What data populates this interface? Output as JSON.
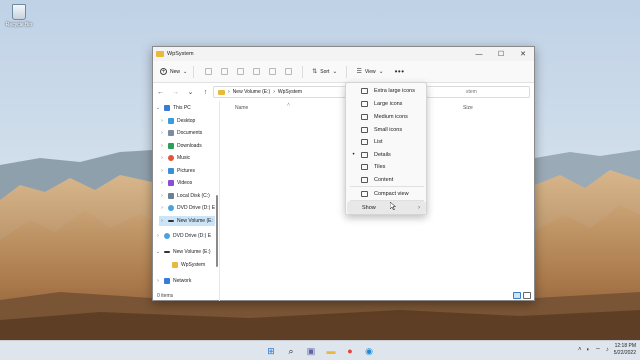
{
  "desktop": {
    "recycle_bin_label": "Recycle Bin"
  },
  "window": {
    "title": "WpSystem",
    "controls": {
      "minimize": "—",
      "maximize": "☐",
      "close": "✕"
    }
  },
  "toolbar": {
    "new_label": "New",
    "sort_label": "Sort",
    "view_label": "View",
    "more_label": "•••"
  },
  "address": {
    "back": "←",
    "forward": "→",
    "recent": "⌄",
    "up": "↑",
    "path": [
      "New Volume (E:)",
      "WpSystem"
    ],
    "separator": "›",
    "search_placeholder": "stem"
  },
  "sidebar": {
    "items": [
      {
        "label": "This PC",
        "chevron": "⌄",
        "icon_color": "#3a7bd5"
      },
      {
        "label": "Desktop",
        "chevron": "›",
        "icon_color": "#3a9be0"
      },
      {
        "label": "Documents",
        "chevron": "›",
        "icon_color": "#7a8c9e"
      },
      {
        "label": "Downloads",
        "chevron": "›",
        "icon_color": "#2f9e5b"
      },
      {
        "label": "Music",
        "chevron": "›",
        "icon_color": "#e0563a"
      },
      {
        "label": "Pictures",
        "chevron": "›",
        "icon_color": "#3a8fd5"
      },
      {
        "label": "Videos",
        "chevron": "›",
        "icon_color": "#8a4fd0"
      },
      {
        "label": "Local Disk (C:)",
        "chevron": "›",
        "icon_color": "#6d7f93"
      },
      {
        "label": "DVD Drive (D:) E",
        "chevron": "›",
        "icon_color": "#4aa3df"
      },
      {
        "label": "New Volume (E:",
        "chevron": "›",
        "icon_color": "#333333"
      },
      {
        "label": "DVD Drive (D:) E",
        "chevron": "›",
        "icon_color": "#4aa3df"
      },
      {
        "label": "New Volume (E:)",
        "chevron": "⌄",
        "icon_color": "#333333"
      },
      {
        "label": "WpSystem",
        "chevron": "",
        "icon_color": "#e8b93c"
      },
      {
        "label": "Network",
        "chevron": "›",
        "icon_color": "#3a7bd5"
      }
    ]
  },
  "content": {
    "col_name": "Name",
    "col_size": "Size",
    "status": "0 items"
  },
  "view_menu": {
    "items": [
      {
        "label": "Extra large icons",
        "bullet": ""
      },
      {
        "label": "Large icons",
        "bullet": ""
      },
      {
        "label": "Medium icons",
        "bullet": ""
      },
      {
        "label": "Small icons",
        "bullet": ""
      },
      {
        "label": "List",
        "bullet": ""
      },
      {
        "label": "Details",
        "bullet": "•"
      },
      {
        "label": "Tiles",
        "bullet": ""
      },
      {
        "label": "Content",
        "bullet": ""
      },
      {
        "label": "Compact view",
        "bullet": ""
      },
      {
        "label": "Show",
        "bullet": "",
        "submenu": "›"
      }
    ]
  },
  "taskbar": {
    "apps": [
      {
        "name": "start",
        "glyph": "⊞",
        "color": "#1f6fd1"
      },
      {
        "name": "search",
        "glyph": "⌕",
        "color": "#222222"
      },
      {
        "name": "chat",
        "glyph": "▣",
        "color": "#6264a7"
      },
      {
        "name": "explorer",
        "glyph": "▬",
        "color": "#e8b93c"
      },
      {
        "name": "chrome",
        "glyph": "●",
        "color": "#e0453a"
      },
      {
        "name": "edge",
        "glyph": "◉",
        "color": "#1c8ad8"
      }
    ],
    "time": "12:18 PM",
    "date": "5/22/2022",
    "tray_chevron": "˄",
    "tray_icons": [
      "◐",
      "⌔",
      "♪"
    ]
  },
  "colors": {
    "accent": "#3e7cc1",
    "selection": "#cce4f7",
    "folder": "#e8b93c"
  }
}
